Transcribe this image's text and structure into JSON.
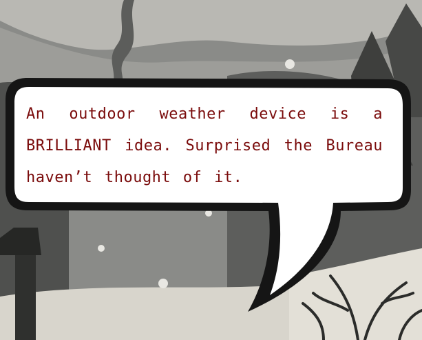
{
  "scene": {
    "description_icons": [
      "snow-icon",
      "tree-icon",
      "chimney-smoke-icon"
    ]
  },
  "speech_bubble": {
    "text": "An outdoor weather device is a BRILLIANT idea. Surprised the Bureau haven’t thought of it.",
    "text_color": "#7a0b0b",
    "fill_color": "#ffffff",
    "border_color": "#151515"
  }
}
